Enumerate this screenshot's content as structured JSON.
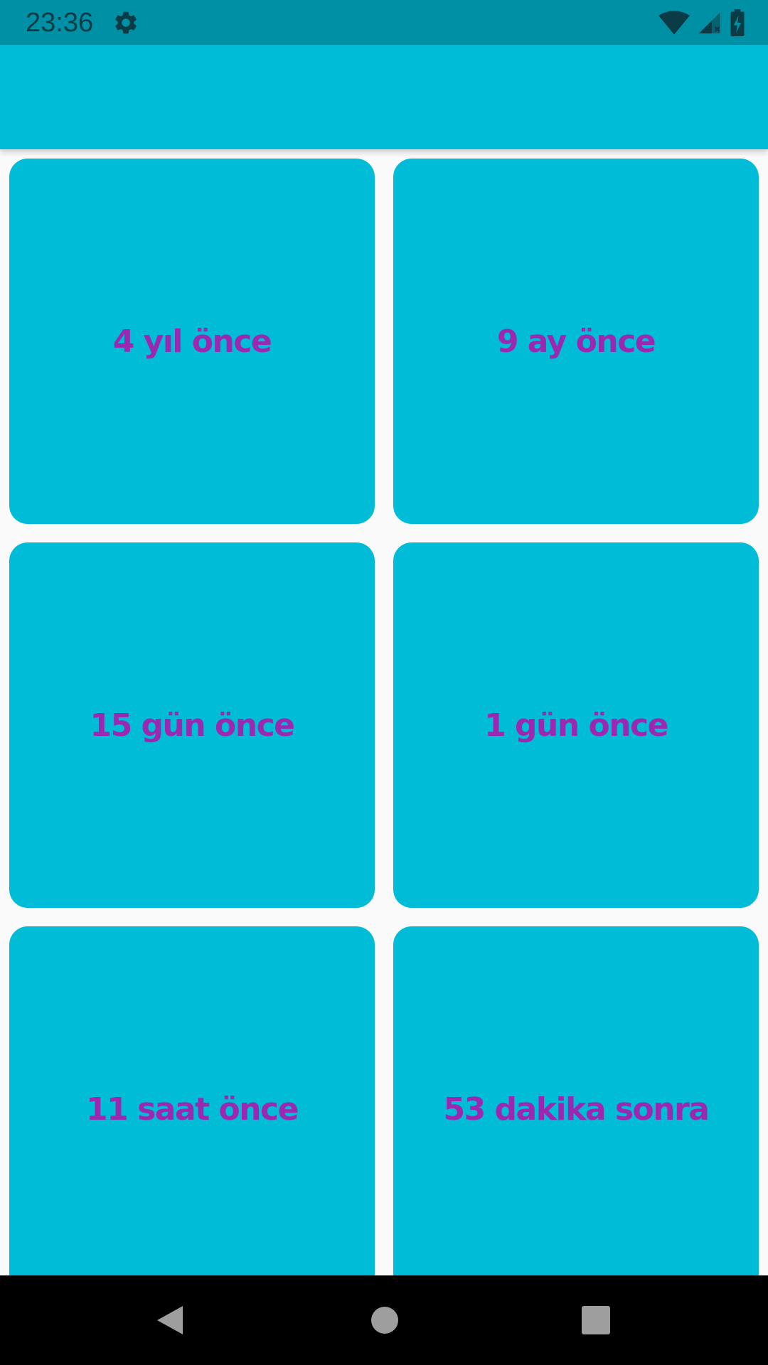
{
  "status_bar": {
    "time": "23:36",
    "icons": [
      "settings-gear-icon",
      "wifi-icon",
      "cell-signal-icon",
      "battery-charging-icon"
    ]
  },
  "colors": {
    "status_bar": "#0090a6",
    "app_bar": "#00bcd6",
    "card": "#00bcd6",
    "card_text": "#9c27b0",
    "background": "#fafafa",
    "nav_bar": "#000000"
  },
  "cards": [
    {
      "label": "4 yıl önce"
    },
    {
      "label": "9 ay önce"
    },
    {
      "label": "15 gün önce"
    },
    {
      "label": "1 gün önce"
    },
    {
      "label": "11 saat önce"
    },
    {
      "label": "53 dakika sonra"
    }
  ],
  "nav_bar": {
    "icons": [
      "back-icon",
      "home-icon",
      "recents-icon"
    ]
  }
}
